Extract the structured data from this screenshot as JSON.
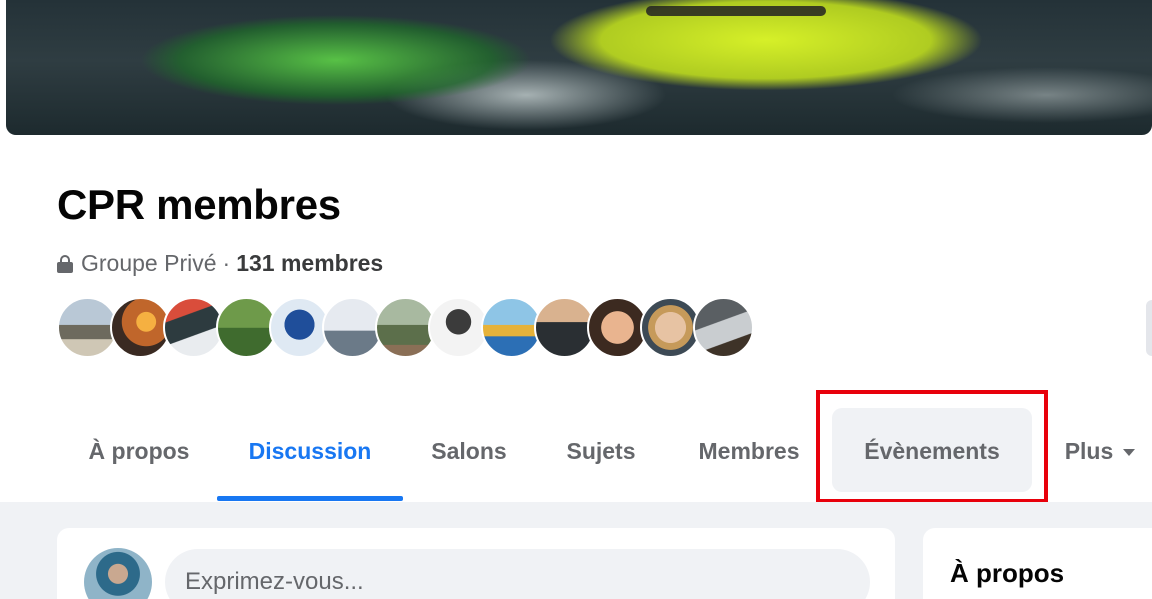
{
  "group": {
    "name": "CPR membres",
    "privacy": "Groupe Privé",
    "separator": "·",
    "member_count": "131 membres"
  },
  "tabs": [
    {
      "label": "À propos",
      "active": false
    },
    {
      "label": "Discussion",
      "active": true
    },
    {
      "label": "Salons",
      "active": false
    },
    {
      "label": "Sujets",
      "active": false
    },
    {
      "label": "Membres",
      "active": false
    },
    {
      "label": "Évènements",
      "active": false,
      "highlighted": true
    },
    {
      "label": "Plus",
      "active": false,
      "has_dropdown": true
    }
  ],
  "composer": {
    "placeholder": "Exprimez-vous..."
  },
  "about_card": {
    "title": "À propos"
  },
  "colors": {
    "accent": "#1877f2",
    "highlight": "#e8000b",
    "text_primary": "#050505",
    "text_secondary": "#65676b",
    "page_bg": "#f0f2f5"
  }
}
